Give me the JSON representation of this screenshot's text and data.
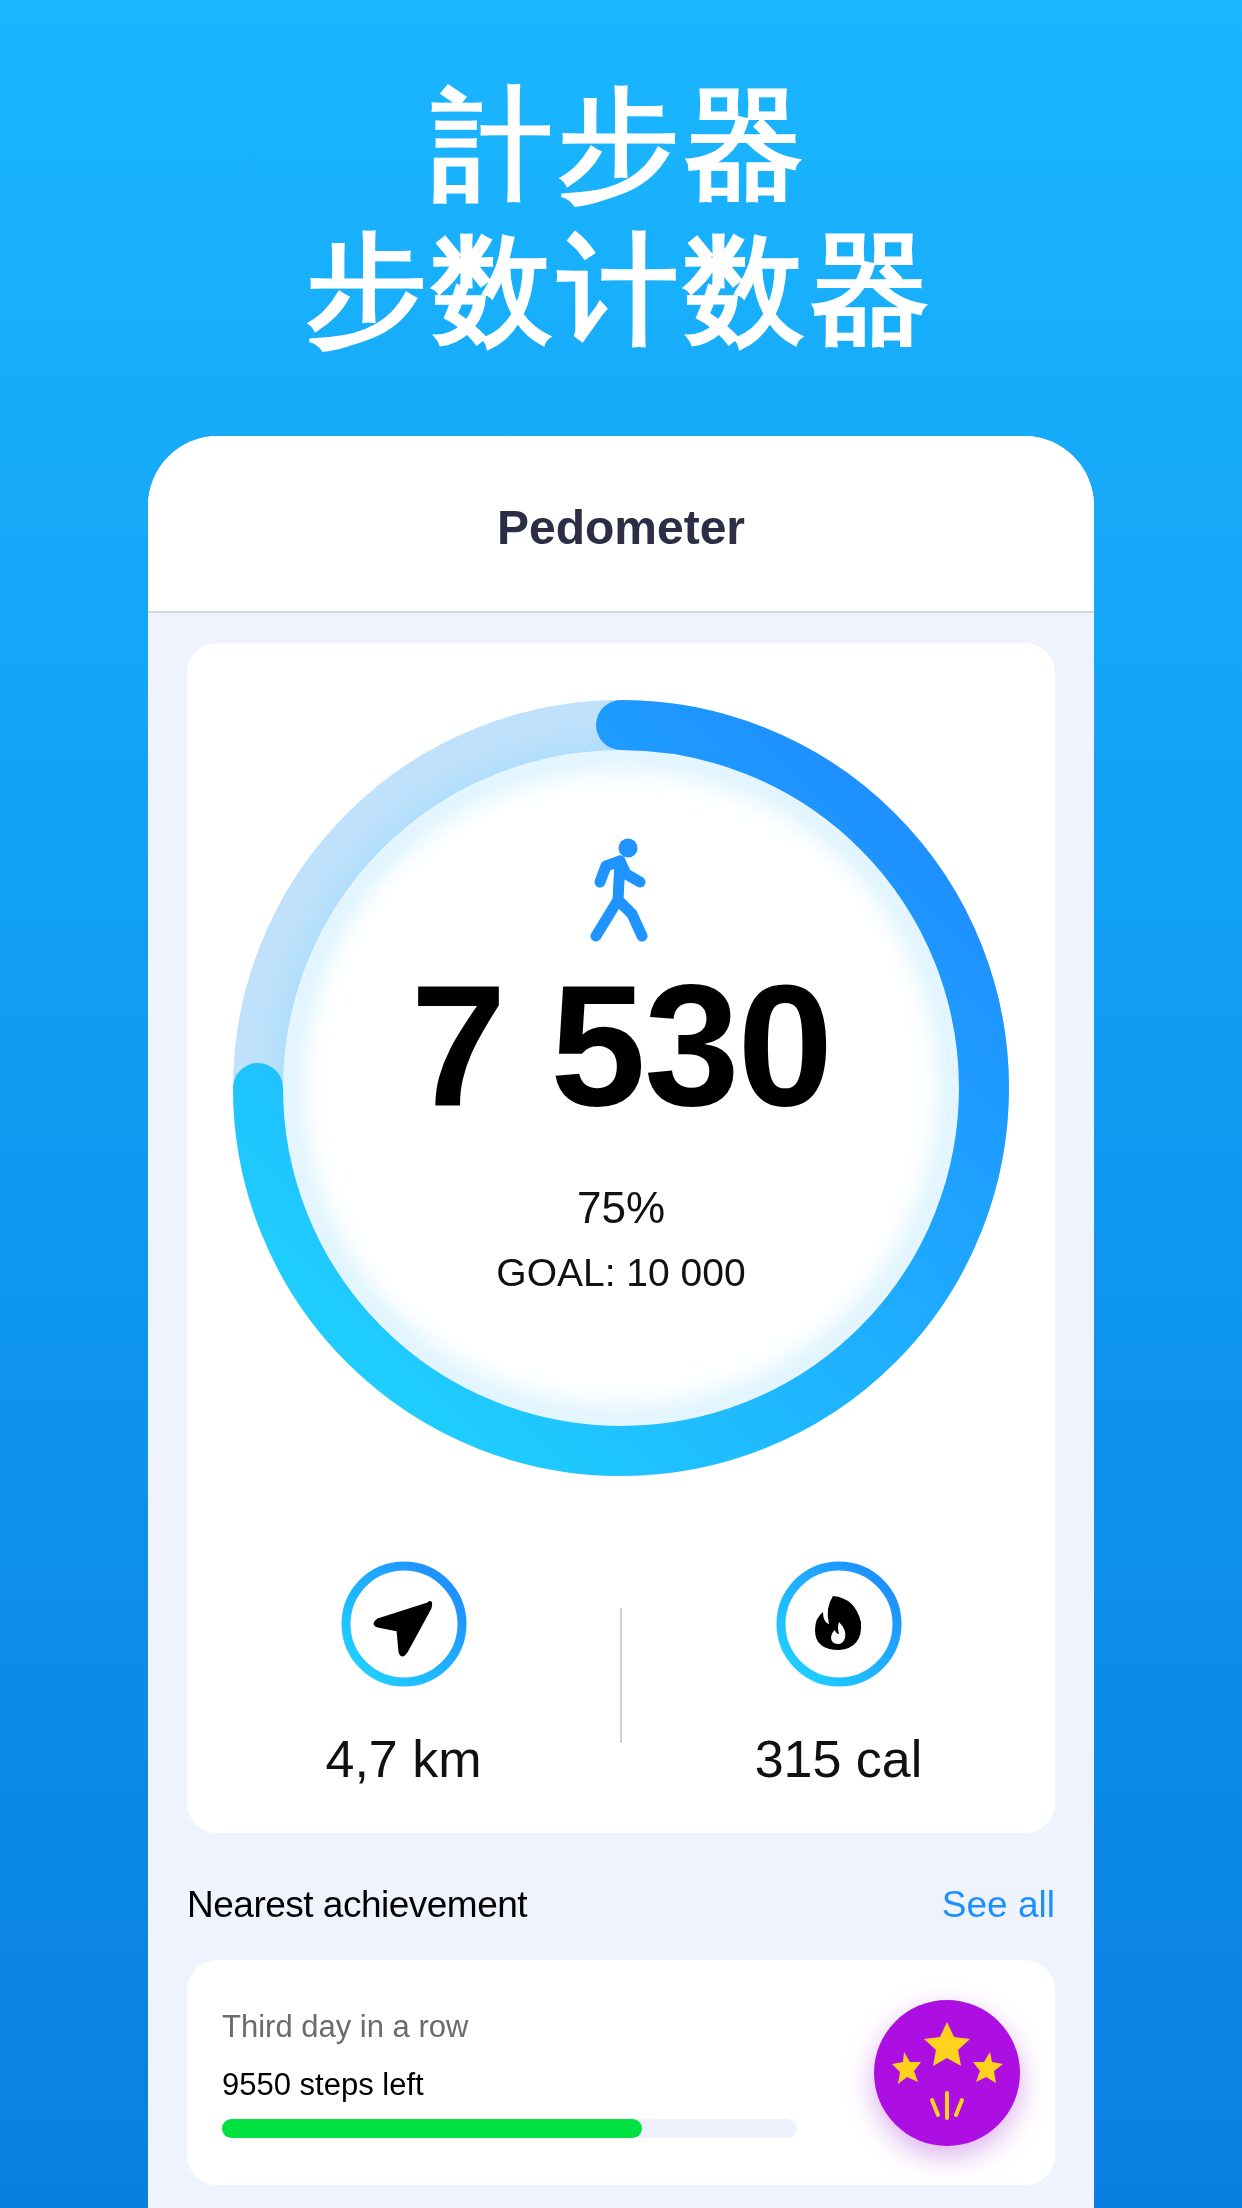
{
  "headline": [
    "計步器",
    "步数计数器"
  ],
  "header": {
    "title": "Pedometer"
  },
  "progress": {
    "steps": "7 530",
    "percent": "75%",
    "goal": "GOAL: 10 000"
  },
  "stats": [
    {
      "kind": "distance",
      "value": "4,7 km"
    },
    {
      "kind": "calories",
      "value": "315 cal"
    }
  ],
  "achievements": {
    "title": "Nearest achievement",
    "link": "See all",
    "card": {
      "name": "Third day in a row",
      "remaining": "9550 steps left",
      "level": 0.73
    }
  }
}
